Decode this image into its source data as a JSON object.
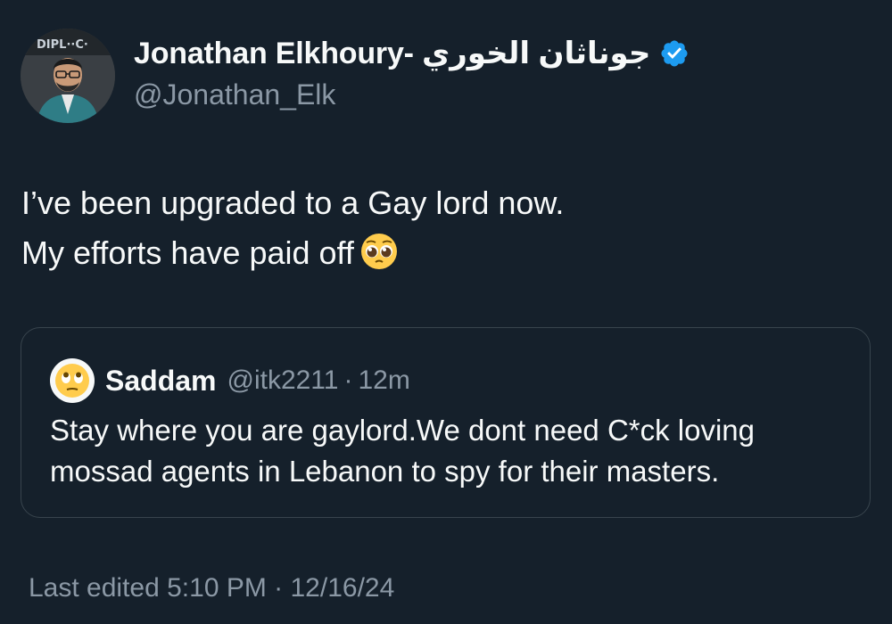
{
  "author": {
    "name": "Jonathan Elkhoury- جوناثان الخوري",
    "handle": "@Jonathan_Elk",
    "verified": true,
    "avatar_icon": "profile-photo",
    "avatar_badge_text": "DIPL··C·"
  },
  "tweet": {
    "lines": [
      "I’ve been upgraded to a Gay lord now.",
      "My efforts have paid off"
    ],
    "emoji": "pleading-face-emoji"
  },
  "quote": {
    "avatar_icon": "face-with-rolling-eyes-emoji",
    "name": "Saddam",
    "handle": "@itk2211",
    "separator": "·",
    "time": "12m",
    "lines": [
      "Stay where you are gaylord.We dont need C*ck loving",
      "mossad agents in Lebanon to spy for their masters."
    ]
  },
  "footer": {
    "edited": "Last edited 5:10 PM · 12/16/24"
  },
  "colors": {
    "background": "#15202b",
    "text_primary": "#f7f9f9",
    "text_secondary": "#8b98a5",
    "border": "#38444d",
    "verified_blue": "#1d9bf0"
  }
}
